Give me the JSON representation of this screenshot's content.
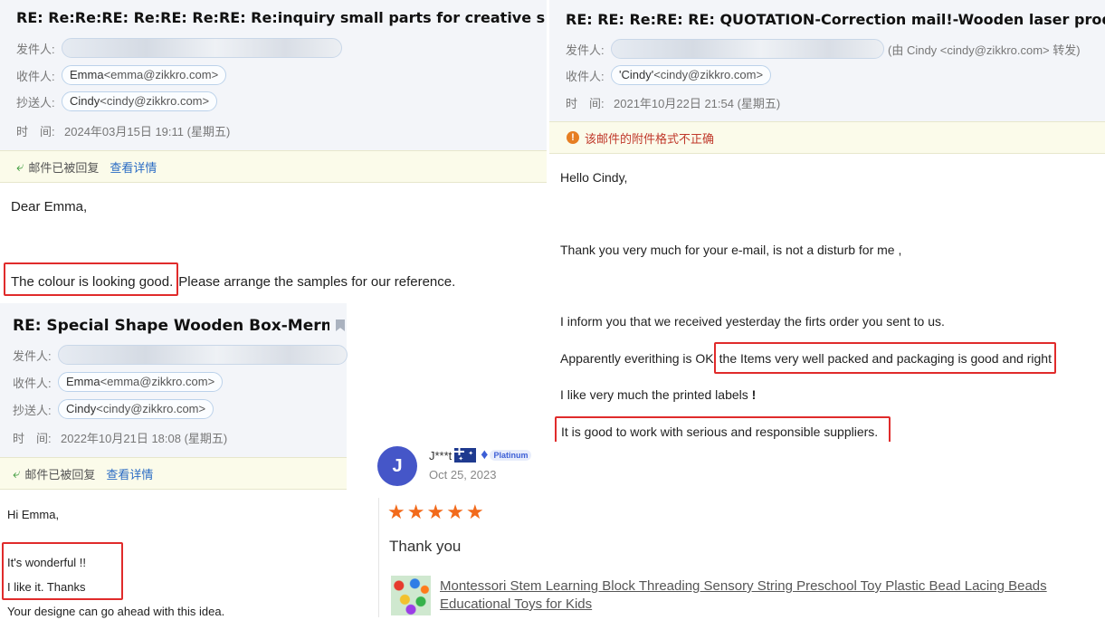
{
  "email1": {
    "subject": "RE: Re:Re:RE: Re:RE: Re:RE: Re:inquiry small parts for creative set \"Ski",
    "from_label": "发件人:",
    "to_label": "收件人:",
    "to_name": "Emma",
    "to_addr": "<emma@zikkro.com>",
    "cc_label": "抄送人:",
    "cc_name": "Cindy",
    "cc_addr": "<cindy@zikkro.com>",
    "time_label": "时　间:",
    "time": "2024年03月15日 19:11 (星期五)",
    "status": "邮件已被回复",
    "detail_link": "查看详情",
    "greeting": "Dear Emma,",
    "highlight": "The colour is looking good.",
    "rest": " Please arrange the samples for our reference."
  },
  "email2": {
    "subject": "RE: RE: Re:RE: RE: QUOTATION-Correction mail!-Wooden laser products",
    "from_label": "发件人:",
    "from_partial": "…",
    "forwarded_note": "(由 Cindy <cindy@zikkro.com> 转发)",
    "to_label": "收件人:",
    "to_name": "'Cindy'",
    "to_addr": "<cindy@zikkro.com>",
    "time_label": "时　间:",
    "time": "2021年10月22日 21:54 (星期五)",
    "warning": "该邮件的附件格式不正确",
    "warning_icon": "!",
    "greeting": "Hello Cindy,",
    "line1": "Thank you very much for your e-mail, is not a disturb for me ,",
    "line2": "I inform you that we received yesterday the firts order you sent to us.",
    "line3_a": "Apparently everithing is OK ",
    "line3_hl": "the Items very well packed and packaging is good and right",
    "line4": "I like very much the printed labels ",
    "line4_bold": "!",
    "line5_hl": "It is good to work with serious and responsible suppliers."
  },
  "email3": {
    "subject": "RE: Special Shape Wooden Box-Mermaid",
    "from_label": "发件人:",
    "to_label": "收件人:",
    "to_name": "Emma",
    "to_addr": "<emma@zikkro.com>",
    "cc_label": "抄送人:",
    "cc_name": "Cindy",
    "cc_addr": "<cindy@zikkro.com>",
    "time_label": "时　间:",
    "time": "2022年10月21日 18:08 (星期五)",
    "status": "邮件已被回复",
    "detail_link": "查看详情",
    "greeting": "Hi Emma,",
    "hl_line1": "It's wonderful !!",
    "hl_line2": "I like it. Thanks",
    "rest": "Your designe can go ahead with this idea."
  },
  "review": {
    "avatar_letter": "J",
    "reviewer": "J***t",
    "badge": "Platinum",
    "date": "Oct 25, 2023",
    "rating": 5,
    "stars": [
      "★",
      "★",
      "★",
      "★",
      "★"
    ],
    "text": "Thank you",
    "product_line1": "Montessori Stem Learning Block Threading Sensory String Preschool Toy Plastic Bead Lacing Beads",
    "product_line2": "Educational Toys for Kids",
    "colors": {
      "avatar": "#4556c8",
      "star": "#f26a1b",
      "badge": "#3d5fd6"
    }
  },
  "colors": {
    "highlight_border": "#e02b2b",
    "link": "#2a6bc4",
    "header_bg": "#f3f5f9",
    "status_bg": "#fbfbea"
  }
}
